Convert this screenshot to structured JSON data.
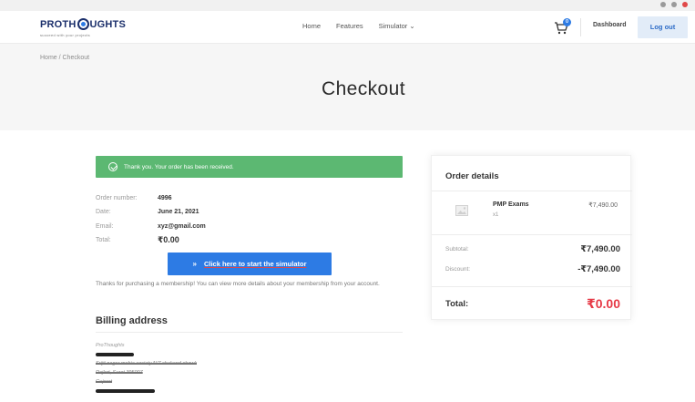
{
  "nav": {
    "logo_prefix": "PROTH",
    "logo_suffix": "UGHTS",
    "logo_tagline": "succeed with your projects",
    "links": [
      "Home",
      "Features",
      "Simulator ⌄"
    ],
    "cart_count": "0",
    "dashboard": "Dashboard",
    "logout": "Log out"
  },
  "hero": {
    "breadcrumb": "Home / Checkout",
    "title": "Checkout"
  },
  "alert": {
    "text": "Thank you. Your order has been received."
  },
  "order": {
    "number_label": "Order number:",
    "number": "4996",
    "date_label": "Date:",
    "date": "June 21, 2021",
    "email_label": "Email:",
    "email": "xyz@gmail.com",
    "total_label": "Total:",
    "total": "₹0.00"
  },
  "cta": {
    "arrow": "»",
    "label": "Click here to start the simulator"
  },
  "thanks": "Thanks for purchasing a membership! You can view more details about your membership from your account.",
  "billing": {
    "title": "Billing address",
    "name": "ProThoughts",
    "address_line": "Srijit nagar mohia society N/7 chakand chowk",
    "city_line": "Rajkot, Surat 395007",
    "state": "Gujarat"
  },
  "summary": {
    "title": "Order details",
    "item_name": "PMP Exams",
    "item_qty": "x1",
    "item_price": "₹7,490.00",
    "subtotal_label": "Subtotal:",
    "subtotal": "₹7,490.00",
    "discount_label": "Discount:",
    "discount": "-₹7,490.00",
    "total_label": "Total:",
    "total": "₹0.00"
  },
  "colors": {
    "brand": "#1b2f6b",
    "accent": "#2d7be4",
    "success": "#5cb872",
    "total_red": "#e63946"
  }
}
